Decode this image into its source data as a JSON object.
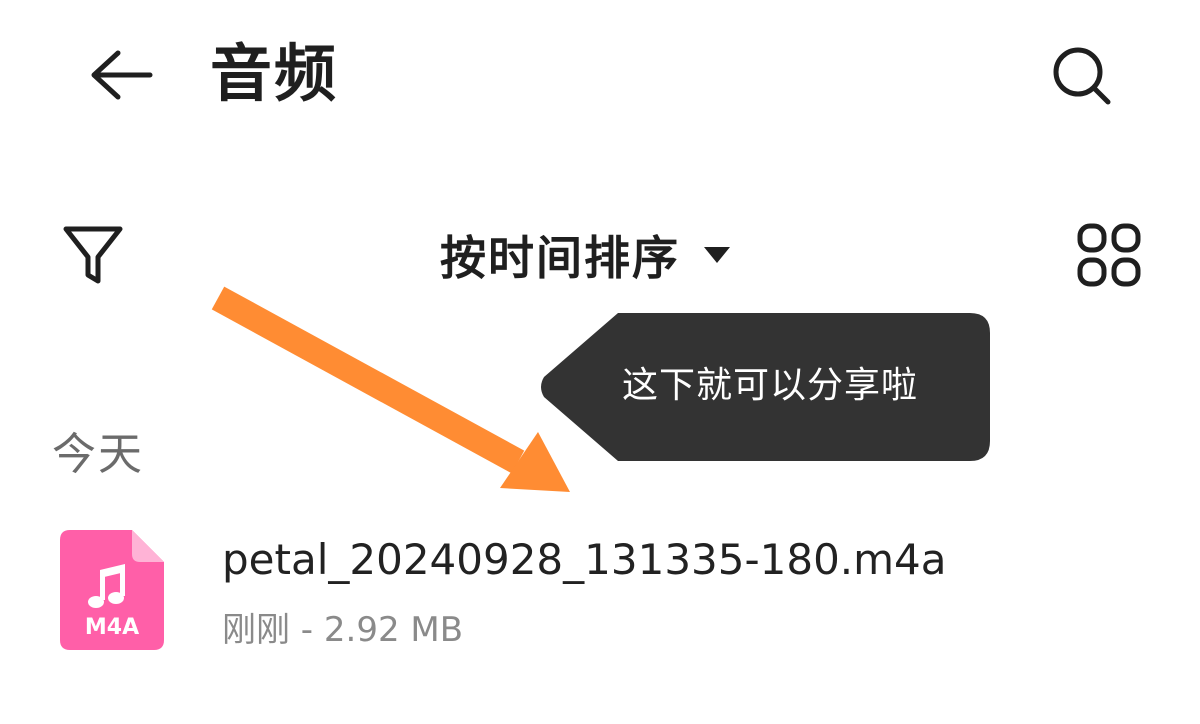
{
  "header": {
    "title": "音频",
    "back_icon": "arrow-left-icon",
    "search_icon": "search-icon"
  },
  "toolbar": {
    "filter_icon": "filter-icon",
    "sort_label": "按时间排序",
    "sort_caret_icon": "caret-down-icon",
    "grid_icon": "grid-view-icon"
  },
  "tooltip": {
    "text": "这下就可以分享啦",
    "background": "#333333"
  },
  "annotation": {
    "arrow_color": "#ff8c33"
  },
  "sections": [
    {
      "header": "今天",
      "files": [
        {
          "name": "petal_20240928_131335-180.m4a",
          "time": "刚刚",
          "separator": " - ",
          "size": "2.92 MB",
          "icon_label": "M4A",
          "icon_color": "#ff5fa8"
        }
      ]
    }
  ]
}
